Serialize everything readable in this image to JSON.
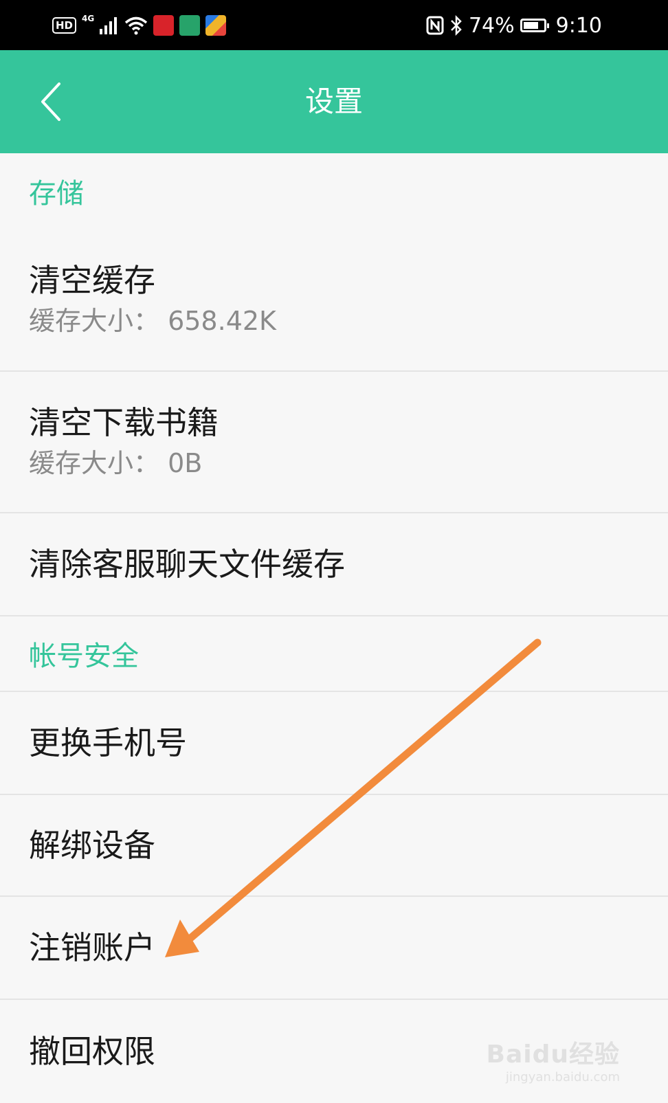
{
  "status_bar": {
    "hd": "HD",
    "network": "4G",
    "battery": "74%",
    "battery_level": 0.74,
    "time": "9:10"
  },
  "header": {
    "title": "设置",
    "back_icon": "chevron-left-icon",
    "bg_color": "#35c59b"
  },
  "sections": {
    "storage": {
      "title": "存储",
      "clear_cache": {
        "title": "清空缓存",
        "subtitle": "缓存大小：  658.42K"
      },
      "clear_books": {
        "title": "清空下载书籍",
        "subtitle": "缓存大小：  0B"
      },
      "clear_chat": {
        "title": "清除客服聊天文件缓存"
      }
    },
    "account": {
      "title": "帐号安全",
      "change_phone": {
        "title": "更换手机号"
      },
      "unbind_device": {
        "title": "解绑设备"
      },
      "cancel_account": {
        "title": "注销账户"
      },
      "revoke": {
        "title": "撤回权限"
      }
    }
  },
  "annotation": {
    "arrow_color": "#f28b3c"
  },
  "watermark": {
    "main": "Baidu经验",
    "sub": "jingyan.baidu.com"
  }
}
